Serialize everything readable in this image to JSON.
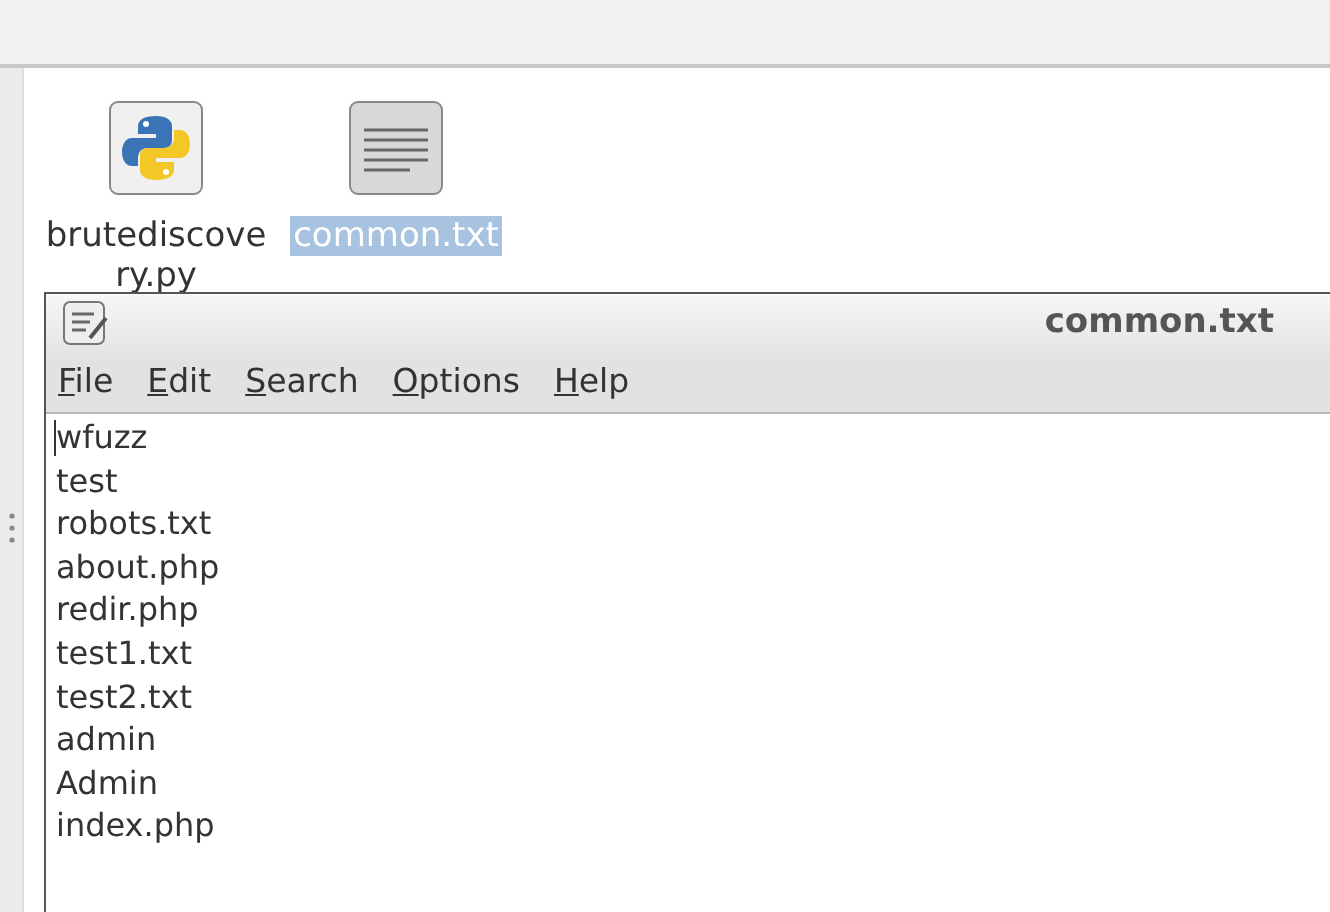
{
  "desktop_icons": [
    {
      "kind": "python",
      "label_lines": [
        "brutediscove",
        "ry.py"
      ],
      "selected": false
    },
    {
      "kind": "text",
      "label_lines": [
        "common.txt"
      ],
      "selected": true
    }
  ],
  "window": {
    "title": "common.txt",
    "menu": [
      "File",
      "Edit",
      "Search",
      "Options",
      "Help"
    ],
    "lines": [
      "wfuzz",
      "test",
      "robots.txt",
      "about.php",
      "redir.php",
      "test1.txt",
      "test2.txt",
      "admin",
      "Admin",
      "index.php"
    ]
  }
}
